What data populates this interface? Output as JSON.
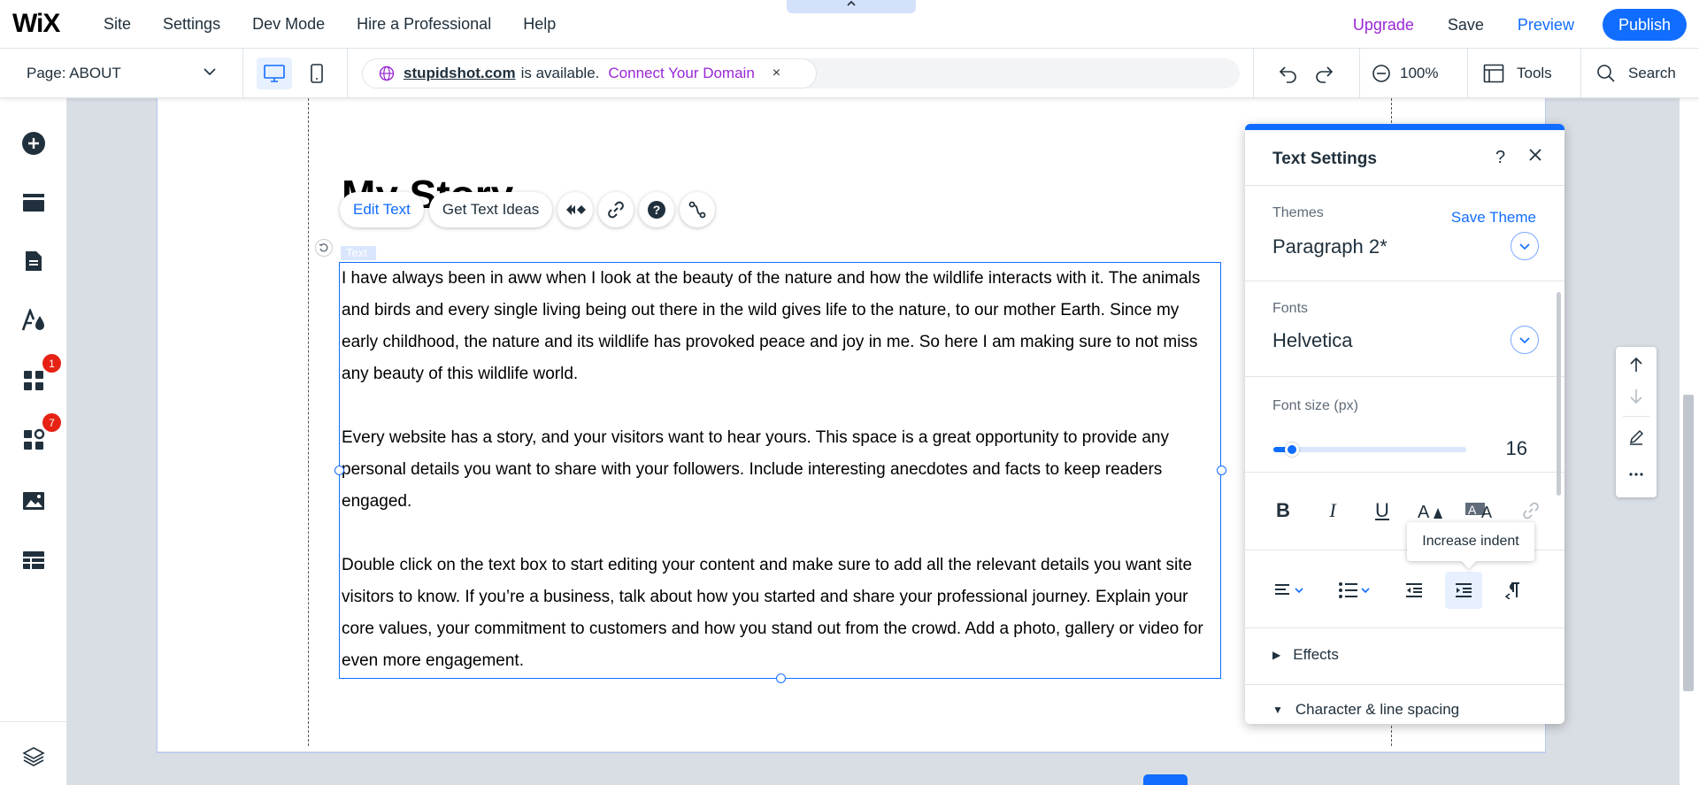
{
  "topbar": {
    "logo": "WiX",
    "menu": [
      "Site",
      "Settings",
      "Dev Mode",
      "Hire a Professional",
      "Help"
    ],
    "upgrade": "Upgrade",
    "save": "Save",
    "preview": "Preview",
    "publish": "Publish",
    "colors": {
      "accent": "#116dff",
      "upgrade": "#9a27d5"
    }
  },
  "toolbar": {
    "page_label": "Page: ABOUT",
    "domain": {
      "name": "stupidshot.com",
      "available_text": "is available.",
      "connect": "Connect Your Domain",
      "close": "×"
    },
    "zoom": "100%",
    "tools": "Tools",
    "search": "Search"
  },
  "sidebar": {
    "items": [
      {
        "icon": "add-icon"
      },
      {
        "icon": "sections-icon"
      },
      {
        "icon": "pages-icon"
      },
      {
        "icon": "design-icon"
      },
      {
        "icon": "apps-icon",
        "badge": "1"
      },
      {
        "icon": "business-apps-icon",
        "badge": "7"
      },
      {
        "icon": "media-icon"
      },
      {
        "icon": "cms-icon"
      },
      {
        "icon": "layers-icon"
      }
    ]
  },
  "canvas": {
    "title": "My Story",
    "floating_toolbar": {
      "edit_text": "Edit Text",
      "get_text_ideas": "Get Text Ideas"
    },
    "text_tag": "Text",
    "paragraphs": [
      "I have always been in aww when I look at the beauty of the nature and how the wildlife interacts with it. The animals and birds and every single living being out there in the wild gives life to the nature, to our mother Earth. Since my early childhood, the nature and its wildlife has provoked peace and joy in me. So here I am making sure to not miss any beauty of this wildlife world.",
      "Every website has a story, and your visitors want to hear yours. This space is a great opportunity to provide any personal details you want to share with your followers. Include interesting anecdotes and facts to keep readers engaged.",
      "Double click on the text box to start editing your content and make sure to add all the relevant details you want site visitors to know. If you’re a business, talk about how you started and share your professional journey. Explain your core values, your commitment to customers and how you stand out from the crowd. Add a photo, gallery or video for even more engagement."
    ]
  },
  "panel": {
    "title": "Text Settings",
    "help": "?",
    "themes_label": "Themes",
    "save_theme": "Save Theme",
    "theme_value": "Paragraph 2*",
    "fonts_label": "Fonts",
    "font_value": "Helvetica",
    "font_size_label": "Font size (px)",
    "font_size_value": "16",
    "font_size_fraction": 0.05,
    "format_buttons": {
      "bold": "B",
      "italic": "I",
      "underline": "U"
    },
    "tooltip": "Increase indent",
    "effects": "Effects",
    "char_spacing": "Character & line spacing"
  }
}
